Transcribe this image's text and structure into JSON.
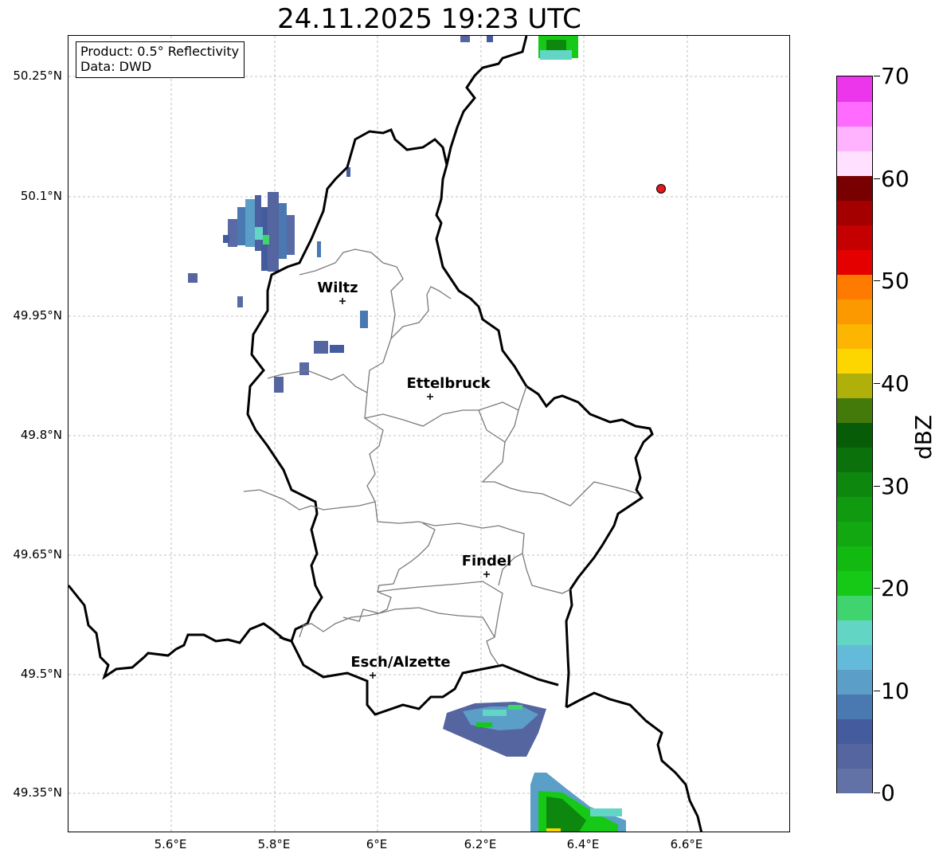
{
  "title": "24.11.2025 19:23 UTC",
  "info": {
    "product": "Product: 0.5° Reflectivity",
    "data": "Data: DWD"
  },
  "lat_ticks": [
    "50.25°N",
    "50.1°N",
    "49.95°N",
    "49.8°N",
    "49.65°N",
    "49.5°N",
    "49.35°N"
  ],
  "lon_ticks": [
    "5.6°E",
    "5.8°E",
    "6°E",
    "6.2°E",
    "6.4°E",
    "6.6°E"
  ],
  "cities": [
    {
      "name": "Wiltz"
    },
    {
      "name": "Ettelbruck"
    },
    {
      "name": "Findel"
    },
    {
      "name": "Esch/Alzette"
    }
  ],
  "colorbar": {
    "label": "dBZ",
    "ticks": [
      "0",
      "10",
      "20",
      "30",
      "40",
      "50",
      "60",
      "70"
    ],
    "colors": [
      "#6271a6",
      "#5565a0",
      "#445c9e",
      "#4a78b0",
      "#5b9ec8",
      "#64bad9",
      "#63d5c4",
      "#3fd46e",
      "#17c917",
      "#11b911",
      "#12a812",
      "#109a10",
      "#0e870e",
      "#0b720b",
      "#075c07",
      "#447a0a",
      "#b0b00a",
      "#fdd600",
      "#fcb500",
      "#fd9900",
      "#ff7a00",
      "#e50000",
      "#c50000",
      "#a50000",
      "#780000",
      "#ffe0ff",
      "#ffb3ff",
      "#ff6bff",
      "#ec36ec"
    ]
  },
  "marker_color": "#e31a1c"
}
